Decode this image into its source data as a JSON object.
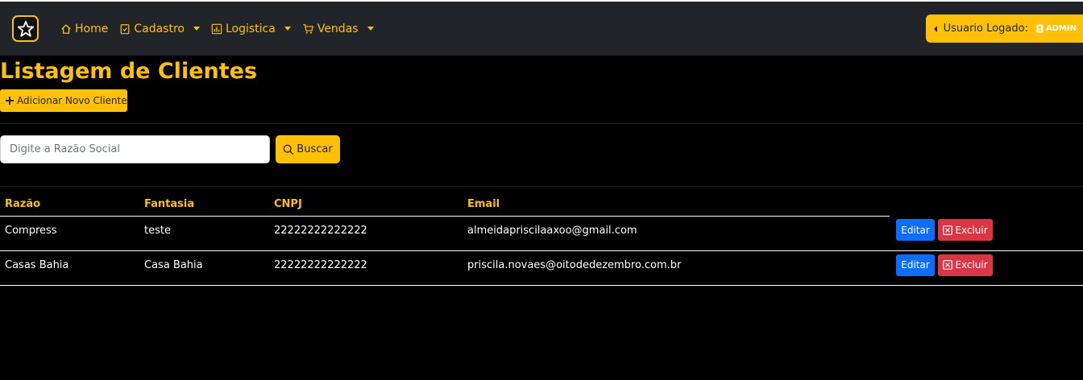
{
  "nav": {
    "home": "Home",
    "cadastro": "Cadastro",
    "logistica": "Logistica",
    "vendas": "Vendas",
    "user_label": "Usuario Logado:",
    "user_name": "ADMIN"
  },
  "page": {
    "title": "Listagem de Clientes",
    "add_button": "Adicionar Novo Cliente"
  },
  "search": {
    "placeholder": "Digite a Razão Social",
    "value": "",
    "button": "Buscar"
  },
  "table": {
    "headers": [
      "Razão",
      "Fantasia",
      "CNPJ",
      "Email"
    ],
    "rows": [
      {
        "razao": "Compress",
        "fantasia": "teste",
        "cnpj": "22222222222222",
        "email": "almeidapriscilaaxoo@gmail.com"
      },
      {
        "razao": "Casas Bahia",
        "fantasia": "Casa Bahia",
        "cnpj": "22222222222222",
        "email": "priscila.novaes@oitodedezembro.com.br"
      }
    ],
    "edit_label": "Editar",
    "delete_label": "Excluir"
  },
  "colors": {
    "accent": "#ffc107",
    "navbar": "#212529",
    "edit": "#0d6efd",
    "delete": "#dc3545"
  }
}
